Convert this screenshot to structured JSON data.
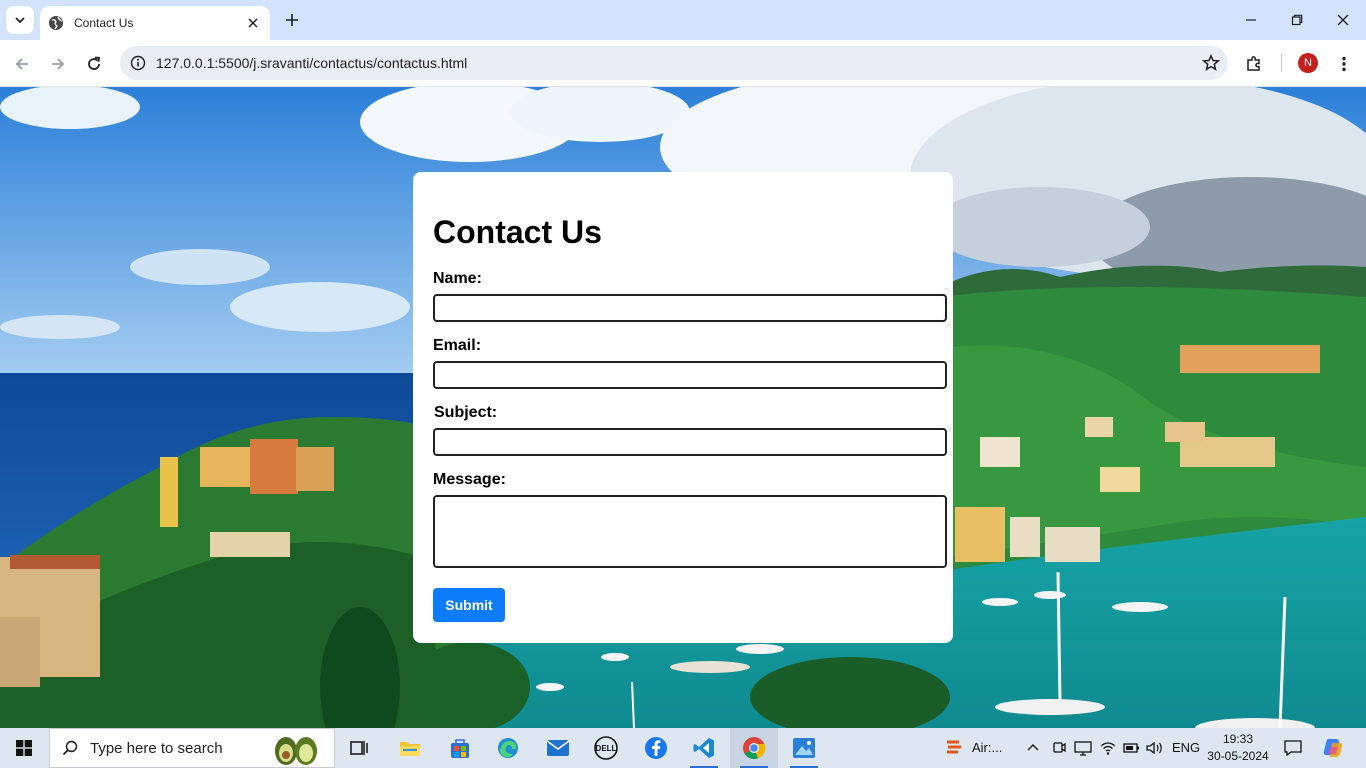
{
  "browser": {
    "tab_title": "Contact Us",
    "url": "127.0.0.1:5500/j.sravanti/contactus/contactus.html",
    "profile_initial": "N"
  },
  "form": {
    "title": "Contact Us",
    "name_label": "Name:",
    "email_label": "Email:",
    "subject_label": "Subject:",
    "message_label": "Message:",
    "name_value": "",
    "email_value": "",
    "subject_value": "",
    "message_value": "",
    "submit_label": "Submit"
  },
  "taskbar": {
    "search_placeholder": "Type here to search",
    "airquality_label": "Air:...",
    "language": "ENG",
    "time": "19:33",
    "date": "30-05-2024"
  },
  "colors": {
    "submit_button": "#0d7cfb",
    "tab_strip": "#d3e3fd",
    "profile_avatar": "#c5221f"
  }
}
